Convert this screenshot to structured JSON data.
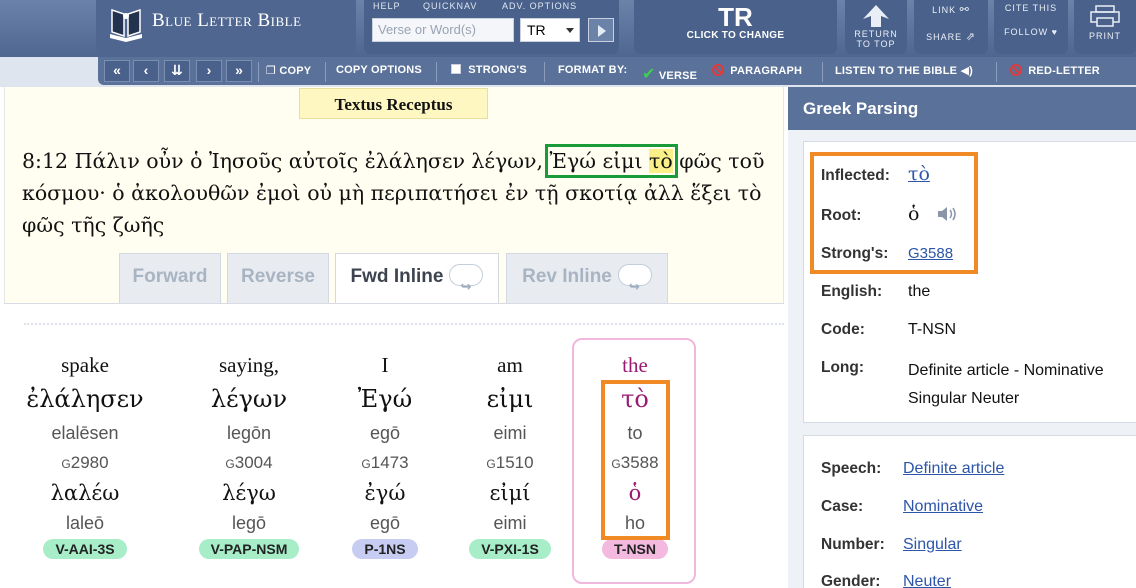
{
  "header": {
    "logo_text": "Blue Letter Bible",
    "help_label": "HELP",
    "quicknav_label": "QUICKNAV",
    "adv_options_label": "ADV. OPTIONS",
    "search_placeholder": "Verse or Word(s)",
    "version_selected": "TR",
    "tr_big": "TR",
    "tr_small": "CLICK TO CHANGE",
    "return_label_1": "RETURN",
    "return_label_2": "TO TOP",
    "link_this": "LINK",
    "share": "SHARE",
    "cite_this": "CITE THIS",
    "follow": "FOLLOW",
    "print": "PRINT"
  },
  "toolbar": {
    "copy": "COPY",
    "copy_options": "COPY OPTIONS",
    "strongs": "STRONG'S",
    "format_by": "FORMAT BY:",
    "verse": "VERSE",
    "paragraph": "PARAGRAPH",
    "listen": "LISTEN TO THE BIBLE",
    "red_letter": "RED-LETTER"
  },
  "verse_panel": {
    "version_tab": "Textus Receptus",
    "ref": "8:12",
    "text_before": "Πάλιν οὖν ὁ Ἰησοῦς αὐτοῖς ἐλάλησεν λέγων, ",
    "hl_text": "Ἐγώ εἰμι ",
    "hl_word": "τὸ",
    "text_after": " φῶς τοῦ κόσμου· ὁ ἀκολουθῶν ἐμοὶ οὐ μὴ περιπατήσει ἐν τῇ σκοτίᾳ ἀλλ ἕξει τὸ φῶς τῆς ζωῆς"
  },
  "mode_tabs": [
    "Forward",
    "Reverse",
    "Fwd Inline",
    "Rev Inline"
  ],
  "interlinear": [
    {
      "eng": "spake",
      "grk": "ἐλάλησεν",
      "translit": "elalēsen",
      "strongs_prefix": "G",
      "strongs_num": "2980",
      "lemma": "λαλέω",
      "lemma_translit": "laleō",
      "code": "V-AAI-3S"
    },
    {
      "eng": "saying,",
      "grk": "λέγων",
      "translit": "legōn",
      "strongs_prefix": "G",
      "strongs_num": "3004",
      "lemma": "λέγω",
      "lemma_translit": "legō",
      "code": "V-PAP-NSM"
    },
    {
      "eng": "I",
      "grk": "Ἐγώ",
      "translit": "egō",
      "strongs_prefix": "G",
      "strongs_num": "1473",
      "lemma": "ἐγώ",
      "lemma_translit": "egō",
      "code": "P-1NS"
    },
    {
      "eng": "am",
      "grk": "εἰμι",
      "translit": "eimi",
      "strongs_prefix": "G",
      "strongs_num": "1510",
      "lemma": "εἰμί",
      "lemma_translit": "eimi",
      "code": "V-PXI-1S"
    },
    {
      "eng": "the",
      "grk": "τὸ",
      "translit": "to",
      "strongs_prefix": "G",
      "strongs_num": "3588",
      "lemma": "ὁ",
      "lemma_translit": "ho",
      "code": "T-NSN"
    }
  ],
  "parsing": {
    "title": "Greek Parsing",
    "inflected_label": "Inflected:",
    "inflected_value": "τὸ",
    "root_label": "Root:",
    "root_value": "ὁ",
    "strongs_label": "Strong's:",
    "strongs_value": "G3588",
    "english_label": "English:",
    "english_value": "the",
    "code_label": "Code:",
    "code_value": "T-NSN",
    "long_label": "Long:",
    "long_value_1": "Definite article - Nominative",
    "long_value_2": "Singular Neuter",
    "speech_label": "Speech:",
    "speech_value": "Definite article",
    "case_label": "Case:",
    "case_value": "Nominative",
    "number_label": "Number:",
    "number_value": "Singular",
    "gender_label": "Gender:",
    "gender_value": "Neuter"
  }
}
